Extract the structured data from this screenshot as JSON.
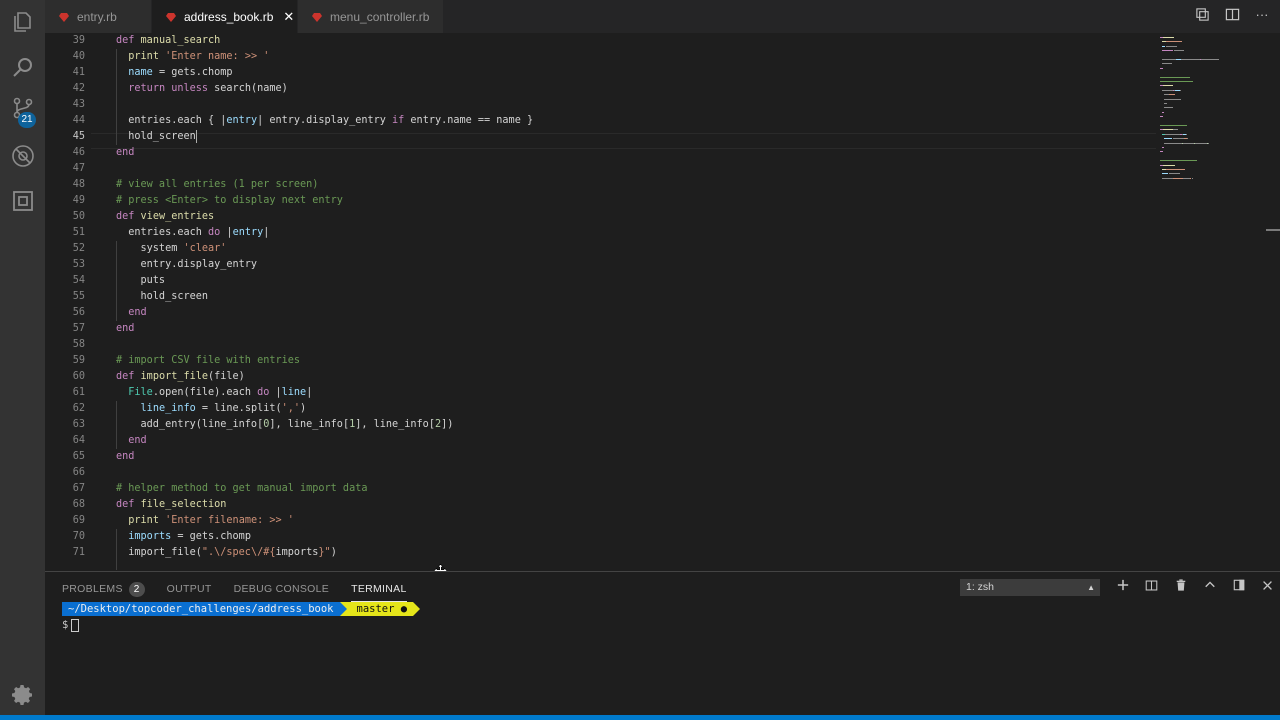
{
  "activity_bar": {
    "icons": [
      "files-icon",
      "search-icon",
      "source-control-icon",
      "debug-icon",
      "extensions-icon"
    ],
    "scm_badge": "21",
    "settings_icon": "gear-icon"
  },
  "tabs": [
    {
      "label": "entry.rb",
      "active": false
    },
    {
      "label": "address_book.rb",
      "active": true,
      "close": "✕"
    },
    {
      "label": "menu_controller.rb",
      "active": false
    }
  ],
  "editor": {
    "lines": [
      {
        "n": "39",
        "t": [
          [
            "kw",
            "def "
          ],
          [
            "fn",
            "manual_search"
          ]
        ]
      },
      {
        "n": "40",
        "t": [
          [
            "op",
            "  "
          ],
          [
            "fn",
            "print "
          ],
          [
            "str",
            "'Enter name: >> '"
          ]
        ]
      },
      {
        "n": "41",
        "t": [
          [
            "op",
            "  "
          ],
          [
            "var",
            "name"
          ],
          [
            "op",
            " = gets.chomp"
          ]
        ]
      },
      {
        "n": "42",
        "t": [
          [
            "op",
            "  "
          ],
          [
            "kw",
            "return unless "
          ],
          [
            "op",
            "search(name)"
          ]
        ]
      },
      {
        "n": "43",
        "t": []
      },
      {
        "n": "44",
        "t": [
          [
            "op",
            "  entries.each { |"
          ],
          [
            "var",
            "entry"
          ],
          [
            "op",
            "| entry.display_entry "
          ],
          [
            "kw",
            "if "
          ],
          [
            "op",
            "entry.name == name }"
          ]
        ]
      },
      {
        "n": "45",
        "t": [
          [
            "op",
            "  hold_screen"
          ]
        ],
        "cursor": true
      },
      {
        "n": "46",
        "t": [
          [
            "kw",
            "end"
          ]
        ]
      },
      {
        "n": "47",
        "t": []
      },
      {
        "n": "48",
        "t": [
          [
            "cm",
            "# view all entries (1 per screen)"
          ]
        ]
      },
      {
        "n": "49",
        "t": [
          [
            "cm",
            "# press <Enter> to display next entry"
          ]
        ]
      },
      {
        "n": "50",
        "t": [
          [
            "kw",
            "def "
          ],
          [
            "fn",
            "view_entries"
          ]
        ]
      },
      {
        "n": "51",
        "t": [
          [
            "op",
            "  entries.each "
          ],
          [
            "kw",
            "do "
          ],
          [
            "op",
            "|"
          ],
          [
            "var",
            "entry"
          ],
          [
            "op",
            "|"
          ]
        ]
      },
      {
        "n": "52",
        "t": [
          [
            "op",
            "    system "
          ],
          [
            "str",
            "'clear'"
          ]
        ]
      },
      {
        "n": "53",
        "t": [
          [
            "op",
            "    entry.display_entry"
          ]
        ]
      },
      {
        "n": "54",
        "t": [
          [
            "op",
            "    puts"
          ]
        ]
      },
      {
        "n": "55",
        "t": [
          [
            "op",
            "    hold_screen"
          ]
        ]
      },
      {
        "n": "56",
        "t": [
          [
            "kw",
            "  end"
          ]
        ]
      },
      {
        "n": "57",
        "t": [
          [
            "kw",
            "end"
          ]
        ]
      },
      {
        "n": "58",
        "t": []
      },
      {
        "n": "59",
        "t": [
          [
            "cm",
            "# import CSV file with entries"
          ]
        ]
      },
      {
        "n": "60",
        "t": [
          [
            "kw",
            "def "
          ],
          [
            "fn",
            "import_file"
          ],
          [
            "op",
            "(file)"
          ]
        ]
      },
      {
        "n": "61",
        "t": [
          [
            "op",
            "  "
          ],
          [
            "cls",
            "File"
          ],
          [
            "op",
            ".open(file).each "
          ],
          [
            "kw",
            "do "
          ],
          [
            "op",
            "|"
          ],
          [
            "var",
            "line"
          ],
          [
            "op",
            "|"
          ]
        ]
      },
      {
        "n": "62",
        "t": [
          [
            "op",
            "    "
          ],
          [
            "var",
            "line_info"
          ],
          [
            "op",
            " = line.split("
          ],
          [
            "str",
            "','"
          ],
          [
            "op",
            ")"
          ]
        ]
      },
      {
        "n": "63",
        "t": [
          [
            "op",
            "    add_entry(line_info["
          ],
          [
            "num",
            "0"
          ],
          [
            "op",
            "], line_info["
          ],
          [
            "num",
            "1"
          ],
          [
            "op",
            "], line_info["
          ],
          [
            "num",
            "2"
          ],
          [
            "op",
            "])"
          ]
        ]
      },
      {
        "n": "64",
        "t": [
          [
            "kw",
            "  end"
          ]
        ]
      },
      {
        "n": "65",
        "t": [
          [
            "kw",
            "end"
          ]
        ]
      },
      {
        "n": "66",
        "t": []
      },
      {
        "n": "67",
        "t": [
          [
            "cm",
            "# helper method to get manual import data"
          ]
        ]
      },
      {
        "n": "68",
        "t": [
          [
            "kw",
            "def "
          ],
          [
            "fn",
            "file_selection"
          ]
        ]
      },
      {
        "n": "69",
        "t": [
          [
            "op",
            "  "
          ],
          [
            "fn",
            "print "
          ],
          [
            "str",
            "'Enter filename: >> '"
          ]
        ]
      },
      {
        "n": "70",
        "t": [
          [
            "op",
            "  "
          ],
          [
            "var",
            "imports"
          ],
          [
            "op",
            " = gets.chomp"
          ]
        ]
      },
      {
        "n": "71",
        "t": [
          [
            "op",
            "  import_file("
          ],
          [
            "str",
            "\".\\/spec\\/#{"
          ],
          [
            "op",
            "imports"
          ],
          [
            "str",
            "}\""
          ],
          [
            "op",
            ")"
          ]
        ]
      }
    ]
  },
  "panel": {
    "tabs": [
      {
        "label": "PROBLEMS",
        "badge": "2"
      },
      {
        "label": "OUTPUT"
      },
      {
        "label": "DEBUG CONSOLE"
      },
      {
        "label": "TERMINAL",
        "active": true
      }
    ],
    "terminal_select": "1: zsh",
    "actions": [
      "add-terminal-icon",
      "split-terminal-icon",
      "trash-icon",
      "maximize-panel-icon",
      "toggle-panel-icon",
      "close-panel-icon"
    ]
  },
  "terminal": {
    "path": "~/Desktop/topcoder_challenges/address_book",
    "branch": "master ●",
    "branch_glyph": "",
    "prompt_char": "$"
  },
  "colors": {
    "activity_bar": "#333333",
    "editor_bg": "#1e1e1e",
    "status_bar": "#007acc",
    "ruby_icon": "#cc342d",
    "prompt_path_bg": "#0a6fd1",
    "prompt_git_bg": "#e5e51a"
  }
}
